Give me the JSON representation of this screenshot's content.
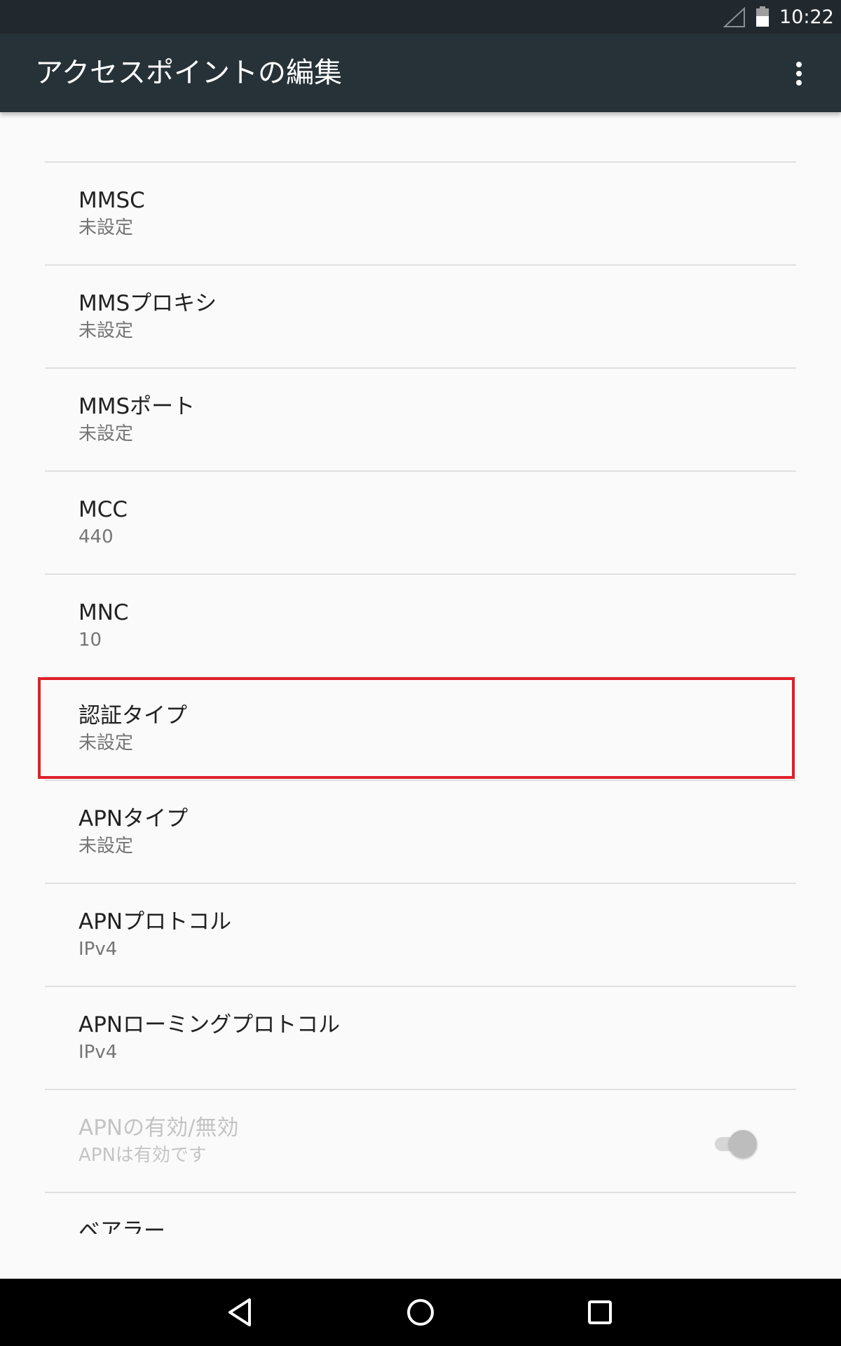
{
  "status_bar": {
    "time": "10:22",
    "icons": [
      "signal-icon",
      "battery-icon"
    ]
  },
  "app_bar": {
    "title": "アクセスポイントの編集",
    "overflow_icon": "more-vert-icon"
  },
  "preferences": [
    {
      "title": "MMSC",
      "summary": "未設定"
    },
    {
      "title": "MMSプロキシ",
      "summary": "未設定"
    },
    {
      "title": "MMSポート",
      "summary": "未設定"
    },
    {
      "title": "MCC",
      "summary": "440"
    },
    {
      "title": "MNC",
      "summary": "10"
    },
    {
      "title": "認証タイプ",
      "summary": "未設定",
      "highlighted": true
    },
    {
      "title": "APNタイプ",
      "summary": "未設定"
    },
    {
      "title": "APNプロトコル",
      "summary": "IPv4"
    },
    {
      "title": "APNローミングプロトコル",
      "summary": "IPv4"
    },
    {
      "title": "APNの有効/無効",
      "summary": "APNは有効です",
      "disabled": true,
      "switch_on": true
    },
    {
      "title": "ベアラー"
    }
  ],
  "highlight_color": "#e0202a",
  "nav_bar": {
    "icons": [
      "back-icon",
      "home-icon",
      "recents-icon"
    ]
  }
}
